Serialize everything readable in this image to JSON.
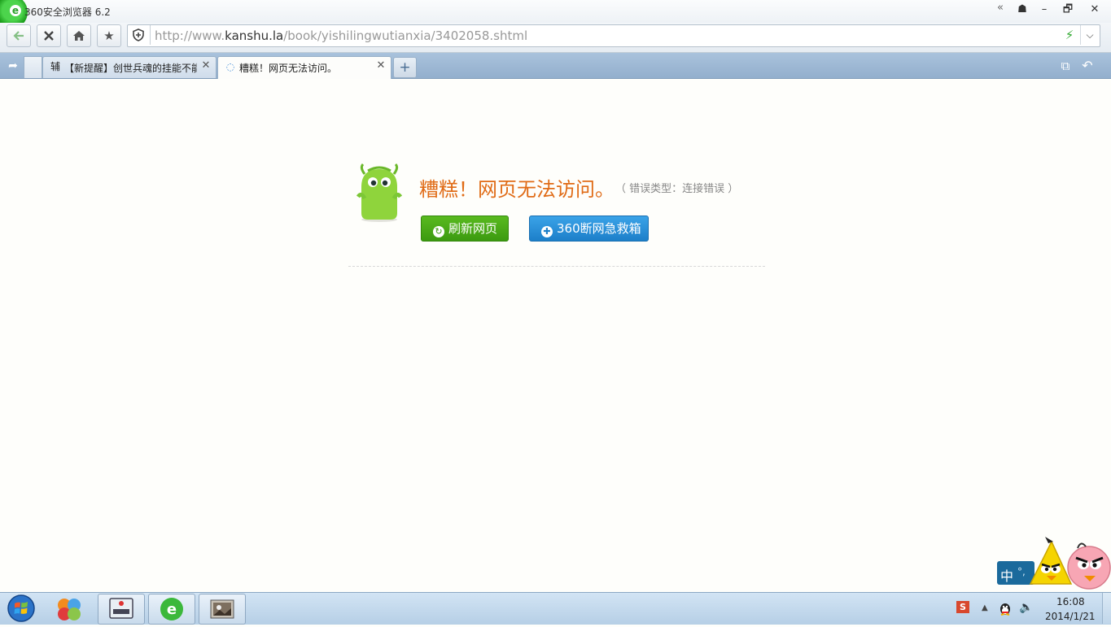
{
  "window": {
    "title": "360安全浏览器 6.2",
    "collapse_glyph": "«",
    "buttons": [
      "☗",
      "–",
      "🗗",
      "✕"
    ]
  },
  "nav": {
    "back_icon": "back-arrow",
    "stop_icon": "stop-x",
    "url_prefix": "http://www.",
    "url_domain": "kanshu.la",
    "url_path": "/book/yishilingwutianxia/3402058.shtml"
  },
  "tabs": [
    {
      "label": "【新提醒】创世兵魂的挂能不能",
      "icon_text": "辅",
      "active": false
    },
    {
      "label": "糟糕！网页无法访问。",
      "icon_text": "◌",
      "active": true
    }
  ],
  "new_tab_label": "+",
  "error": {
    "title": "糟糕！网页无法访问。",
    "type_label": "（ 错误类型：连接错误 ）",
    "refresh_button": "刷新网页",
    "rescue_button": "360断网急救箱"
  },
  "ime": {
    "mode": "中",
    "punct": "°,"
  },
  "taskbar": {
    "time": "16:08",
    "date": "2014/1/21",
    "tray_sogou": "S"
  },
  "colors": {
    "error_title": "#e06b16",
    "refresh_green": "#3c9a10",
    "rescue_blue": "#1d7fc9",
    "tabbar_blue": "#93afcd"
  }
}
